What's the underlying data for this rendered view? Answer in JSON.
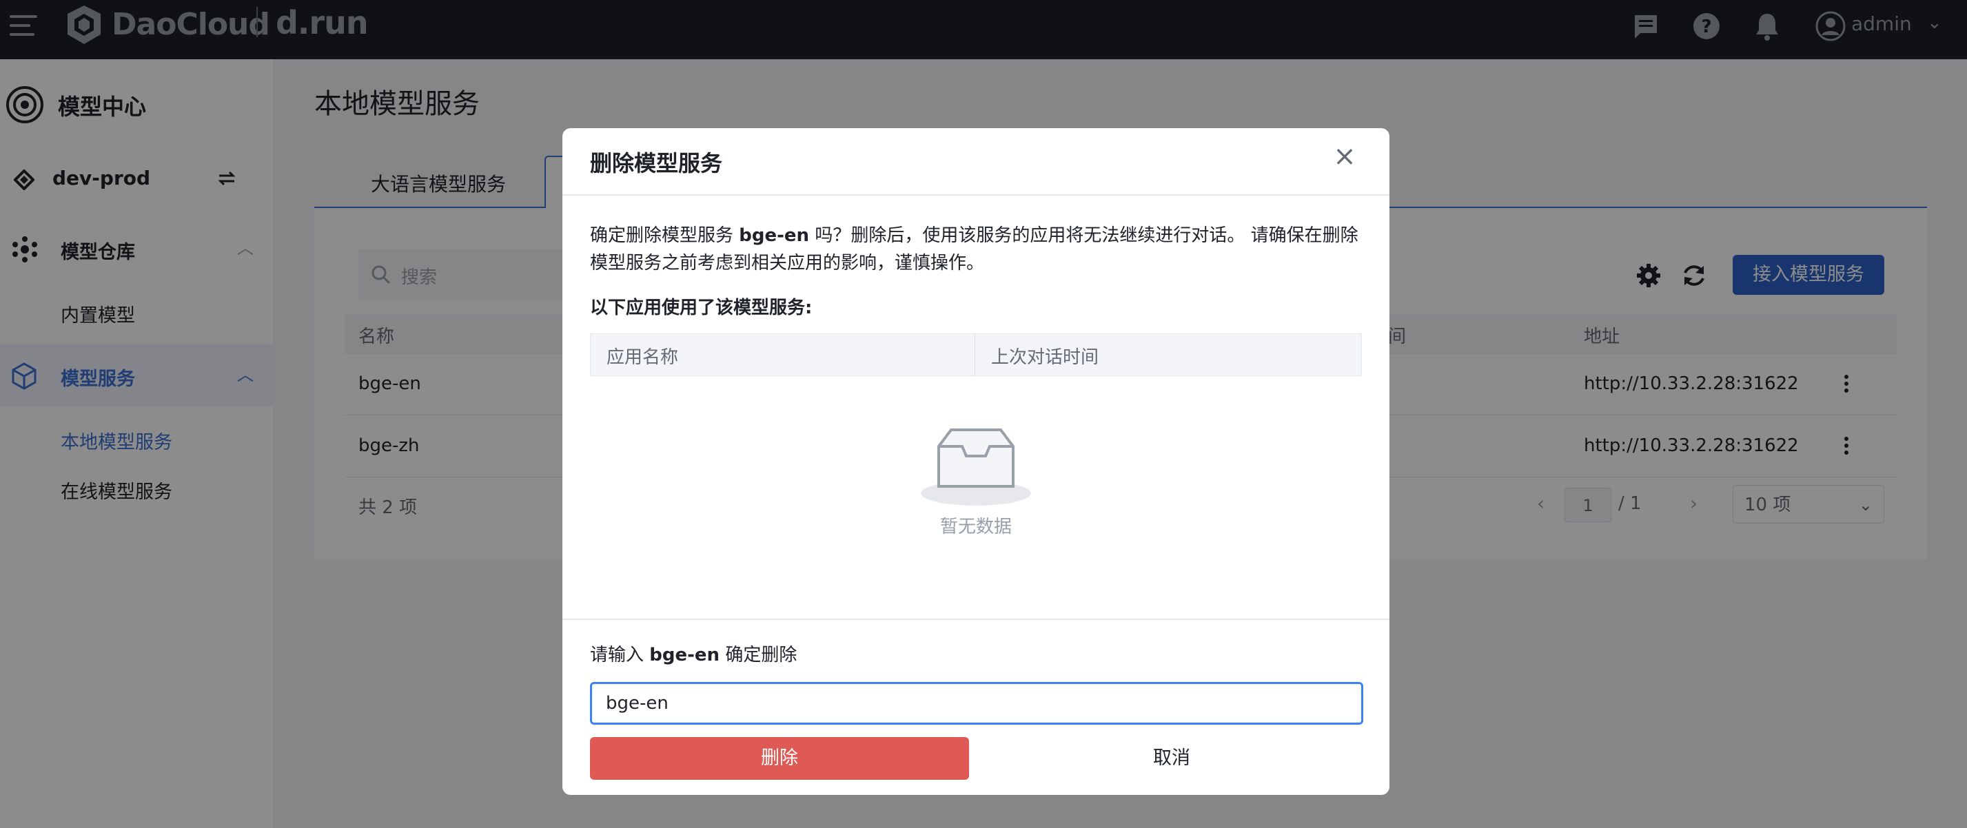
{
  "topbar": {
    "brand": "DaoCloud",
    "brand2": "d.run",
    "user": "admin",
    "icons": [
      "menu-icon",
      "message-icon",
      "help-icon",
      "bell-icon",
      "user-icon",
      "chevron-down-icon"
    ]
  },
  "sidebar": {
    "title": "模型中心",
    "workspace": "dev-prod",
    "groups": [
      {
        "label": "模型仓库",
        "items": [
          "内置模型"
        ]
      },
      {
        "label": "模型服务",
        "items": [
          "本地模型服务",
          "在线模型服务"
        ]
      }
    ],
    "active_item": "本地模型服务",
    "accent_color": "#3b6fd3"
  },
  "main": {
    "page_title": "本地模型服务",
    "tabs": [
      "大语言模型服务",
      ""
    ],
    "search_placeholder": "搜索",
    "add_button": "接入模型服务",
    "columns": [
      "名称",
      "间",
      "地址"
    ],
    "rows": [
      {
        "name": "bge-en",
        "address": "http://10.33.2.28:31622"
      },
      {
        "name": "bge-zh",
        "address": "http://10.33.2.28:31622"
      }
    ],
    "total": "共 2 项",
    "pagination": {
      "current": "1",
      "total": "/ 1",
      "page_size": "10 项"
    }
  },
  "dialog": {
    "title": "删除模型服务",
    "message_pre": "确定删除模型服务 ",
    "message_name": "bge-en",
    "message_post": " 吗？删除后，使用该服务的应用将无法继续进行对话。 请确保在删除模型服务之前考虑到相关应用的影响，谨慎操作。",
    "apps_heading": "以下应用使用了该模型服务:",
    "table_columns": [
      "应用名称",
      "上次对话时间"
    ],
    "empty_text": "暂无数据",
    "confirm_pre": "请输入 ",
    "confirm_name": "bge-en",
    "confirm_post": " 确定删除",
    "input_value": "bge-en",
    "delete_button": "删除",
    "cancel_button": "取消",
    "danger_color": "#df5a55"
  }
}
